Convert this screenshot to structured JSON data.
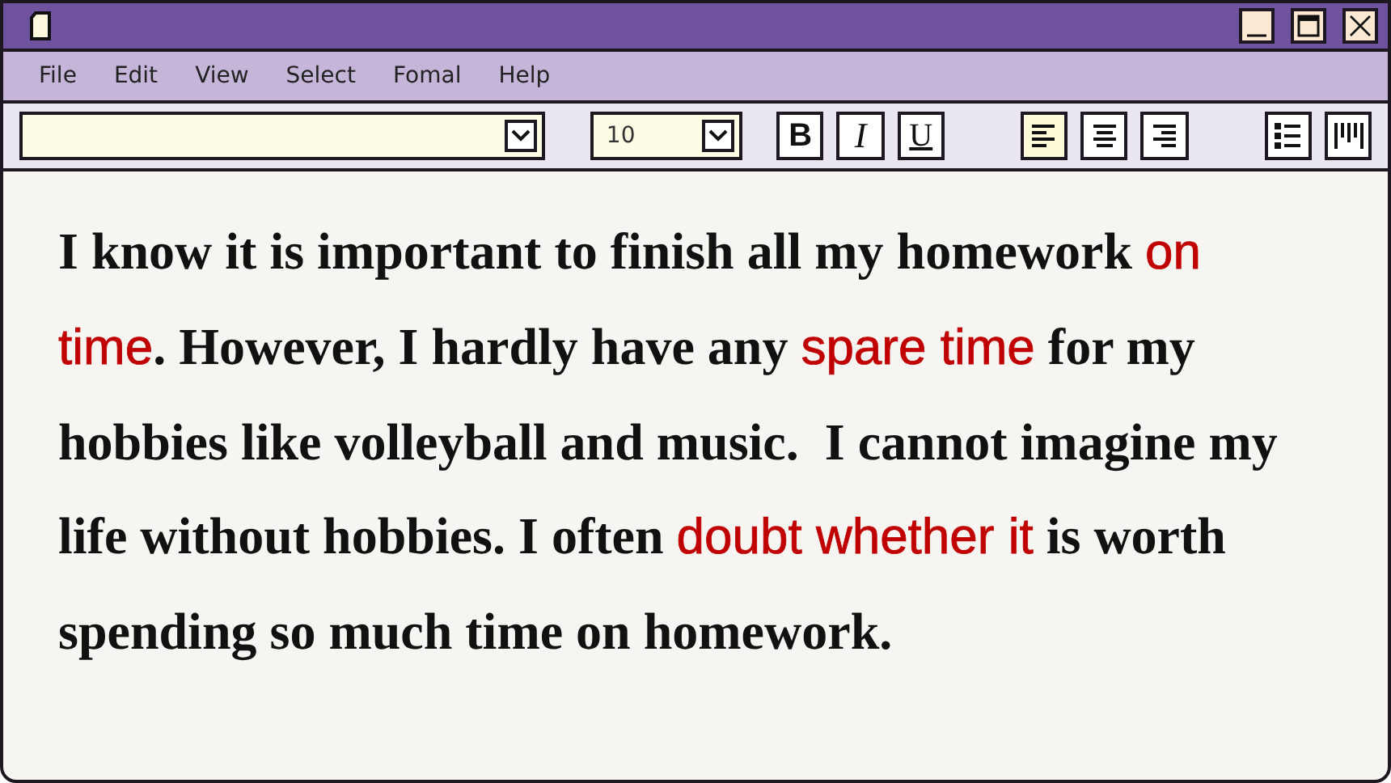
{
  "menu": [
    "File",
    "Edit",
    "View",
    "Select",
    "Fomal",
    "Help"
  ],
  "toolbar": {
    "size_field": {
      "value": "10"
    },
    "styles": [
      {
        "label": "B",
        "kind": "bold"
      },
      {
        "label": "I",
        "kind": "italic"
      },
      {
        "label": "U",
        "kind": "underline"
      }
    ],
    "alignment": [
      {
        "kind": "left",
        "selected": true
      },
      {
        "kind": "center",
        "selected": false
      },
      {
        "kind": "right",
        "selected": false
      }
    ],
    "lists": [
      {
        "kind": "bullets"
      },
      {
        "kind": "columns"
      }
    ]
  },
  "document": {
    "lines": [
      [
        {
          "text": "I know it is important to finish all my homework ",
          "highlight": false
        },
        {
          "text": "on",
          "highlight": true
        }
      ],
      [
        {
          "text": "time",
          "highlight": true
        },
        {
          "text": ". However, I hardly have any ",
          "highlight": false
        },
        {
          "text": "spare time",
          "highlight": true
        },
        {
          "text": " for my",
          "highlight": false
        }
      ],
      [
        {
          "text": "hobbies like volleyball and music.  I cannot imagine my",
          "highlight": false
        }
      ],
      [
        {
          "text": "life without hobbies. I often ",
          "highlight": false
        },
        {
          "text": "doubt whether it",
          "highlight": true
        },
        {
          "text": " is worth",
          "highlight": false
        }
      ],
      [
        {
          "text": "spending so much time on homework.",
          "highlight": false
        }
      ]
    ]
  }
}
